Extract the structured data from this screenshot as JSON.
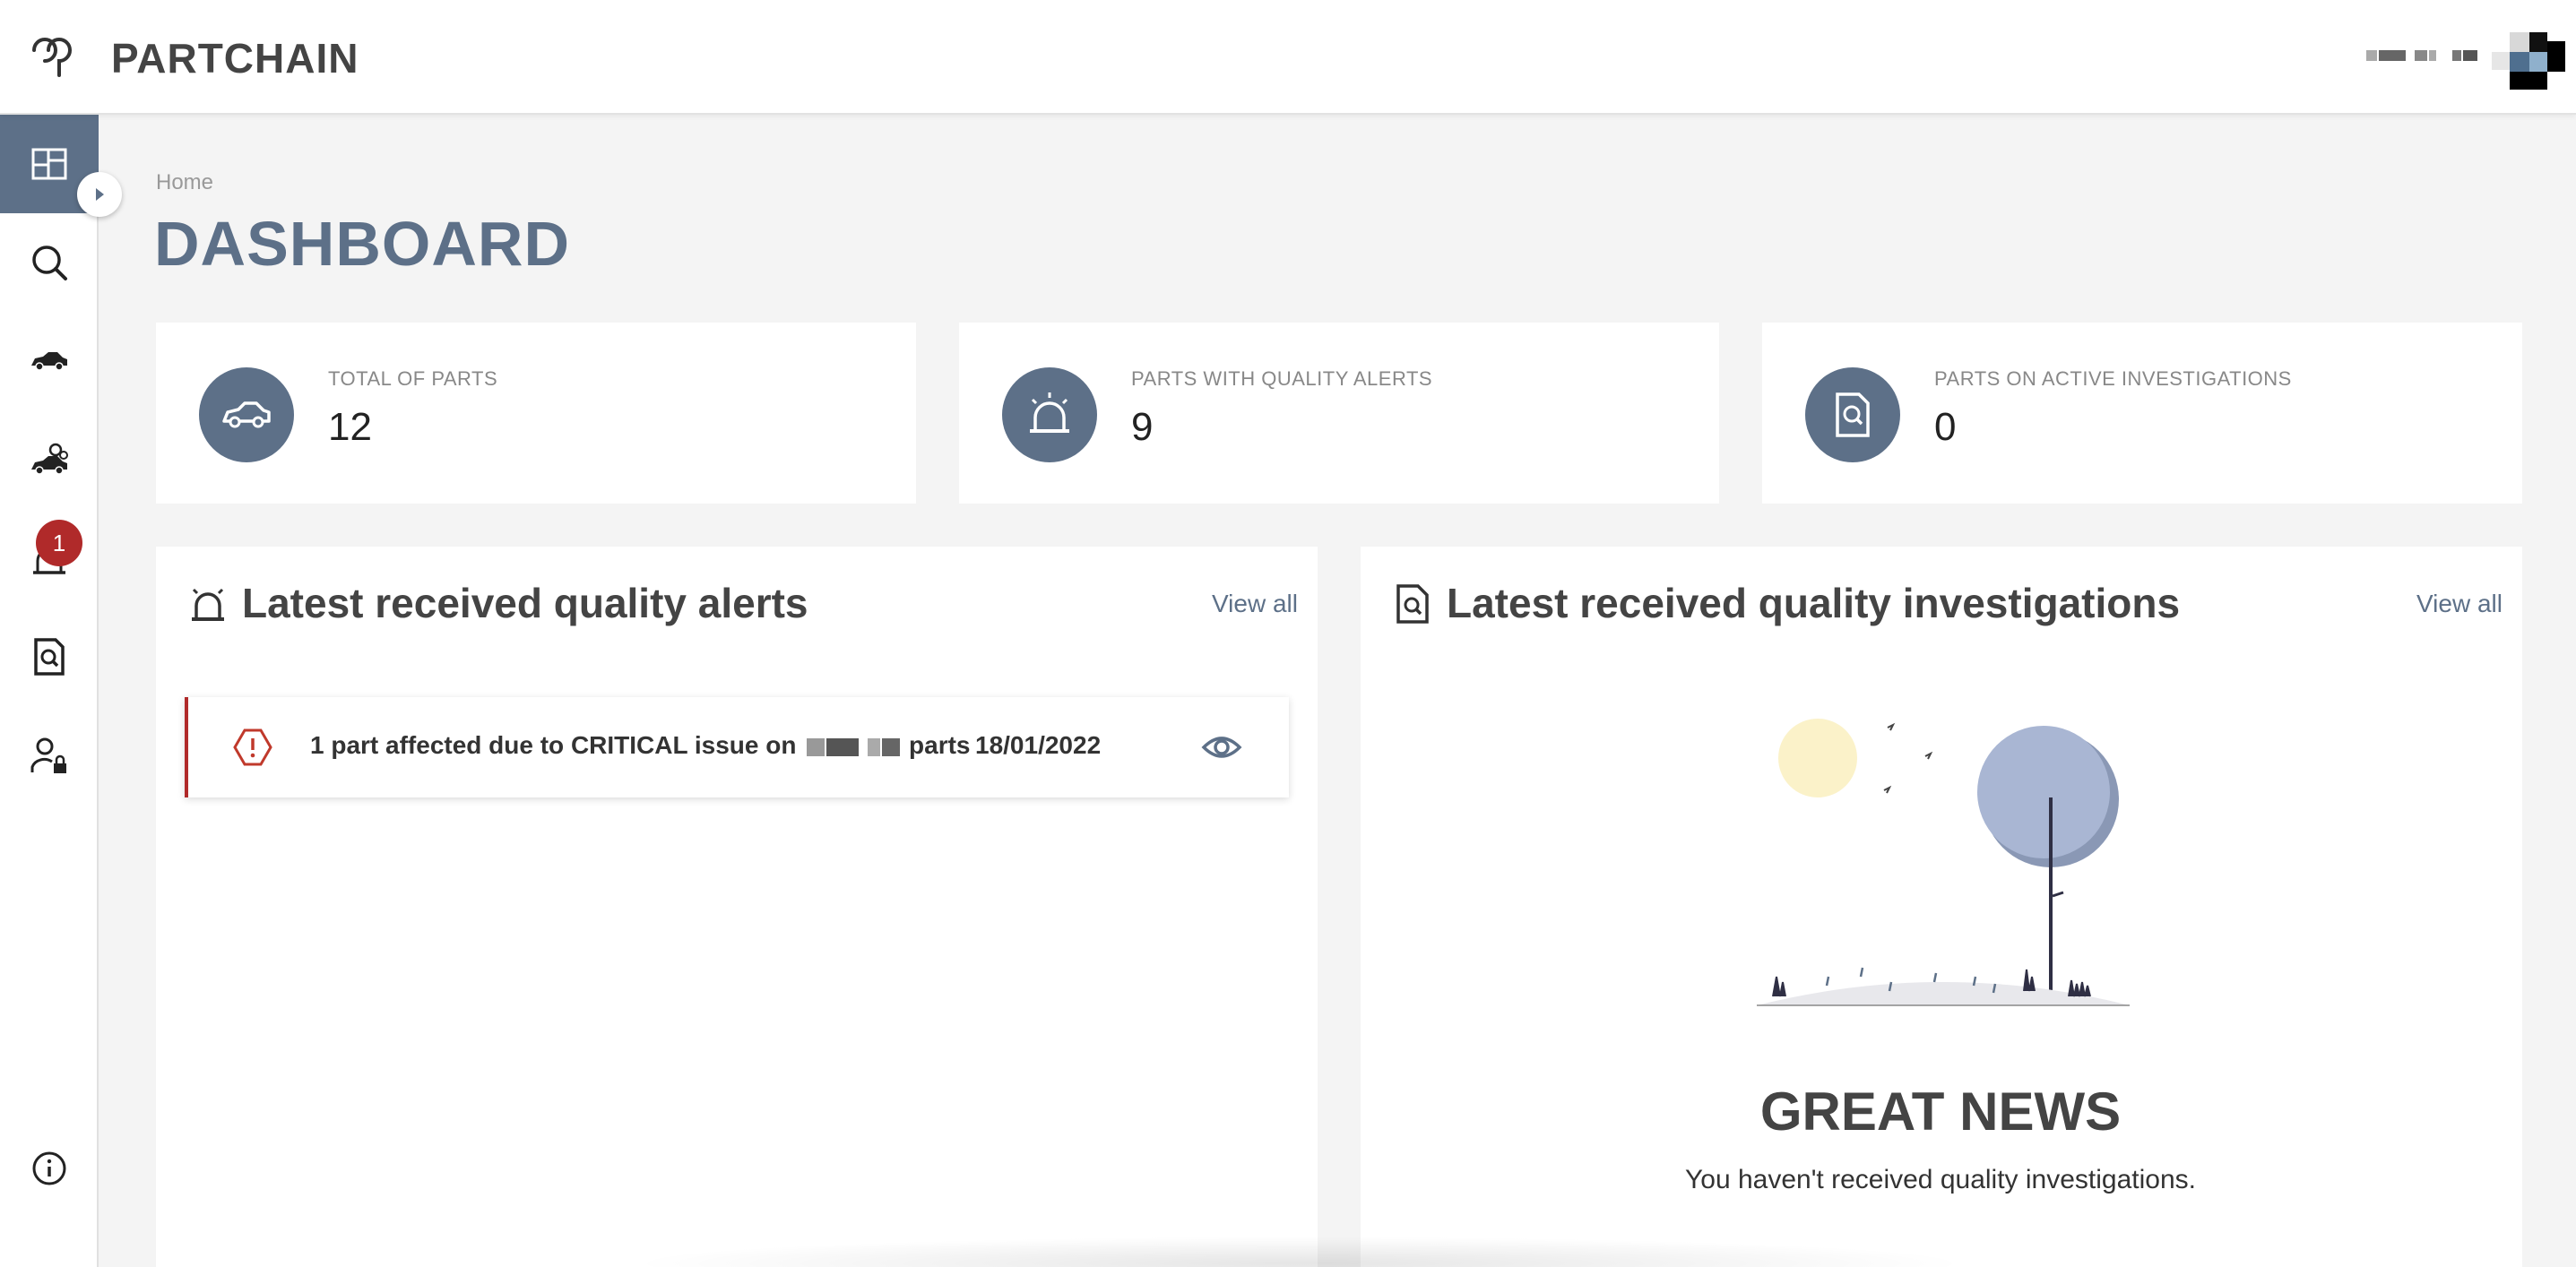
{
  "header": {
    "app_title": "PARTCHAIN",
    "logo_icon": "partchain-logo-icon"
  },
  "sidebar": {
    "items": [
      {
        "name": "dashboard",
        "icon": "dashboard-icon",
        "active": true
      },
      {
        "name": "search",
        "icon": "search-icon"
      },
      {
        "name": "parts",
        "icon": "car-icon"
      },
      {
        "name": "other-parts",
        "icon": "car-gear-icon"
      },
      {
        "name": "quality-alerts",
        "icon": "alarm-icon",
        "badge": "1"
      },
      {
        "name": "quality-investigations",
        "icon": "document-search-icon"
      },
      {
        "name": "admin",
        "icon": "user-lock-icon"
      },
      {
        "name": "about",
        "icon": "info-icon"
      }
    ]
  },
  "breadcrumb": "Home",
  "page_title": "DASHBOARD",
  "stats": [
    {
      "label": "TOTAL OF PARTS",
      "value": "12",
      "icon": "car-icon"
    },
    {
      "label": "PARTS WITH QUALITY ALERTS",
      "value": "9",
      "icon": "alarm-icon"
    },
    {
      "label": "PARTS ON ACTIVE INVESTIGATIONS",
      "value": "0",
      "icon": "document-search-icon"
    }
  ],
  "alerts_panel": {
    "title": "Latest received quality alerts",
    "view_all": "View all",
    "rows": [
      {
        "text_before": "1 part affected due to CRITICAL issue on",
        "text_after": "parts",
        "date": "18/01/2022"
      }
    ]
  },
  "investigations_panel": {
    "title": "Latest received quality investigations",
    "view_all": "View all",
    "empty_title": "GREAT NEWS",
    "empty_text": "You haven't received quality investigations."
  },
  "colors": {
    "accent": "#5d7088",
    "alert_red": "#b02a2a",
    "background": "#f4f4f4"
  }
}
